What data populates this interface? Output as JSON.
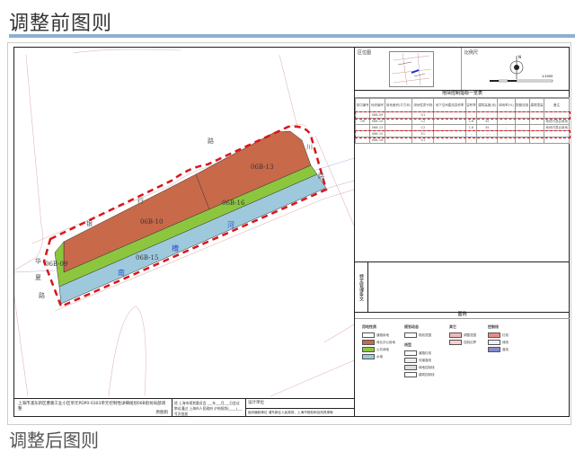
{
  "page": {
    "title": "调整前图则",
    "next_title": "调整后图则"
  },
  "map": {
    "parcels": [
      "06B-09",
      "06B-10",
      "06B-13",
      "06B-15",
      "06B-16"
    ],
    "roads": {
      "top": [
        "银",
        "行",
        "路"
      ],
      "left": [
        "华",
        "夏",
        "路"
      ],
      "right": [
        "川",
        "路"
      ]
    },
    "river": [
      "南",
      "槽",
      "河"
    ],
    "colors": {
      "commercial": "#c8694a",
      "green": "#8cc63f",
      "water": "#9ec9dc",
      "boundary": "#d9141b"
    }
  },
  "panel": {
    "location_label": "区位图",
    "scale_label": "比例尺",
    "scale_value": "1:2000",
    "north": "N",
    "table_title": "地块控制指标一览表",
    "table_headers": [
      "街坊编号",
      "地块编号",
      "用地面积(平方米)",
      "用地性质代码",
      "地下空间建设容积率",
      "容积率",
      "建筑高度(米)",
      "绿地率(%)",
      "配套设施",
      "建筑限高",
      "备注"
    ],
    "table_rows": [
      [
        "",
        "06B-09",
        "",
        "G1",
        "",
        "-",
        "-",
        "-",
        "",
        "",
        ""
      ],
      [
        "06",
        "06B-10",
        "",
        "C2",
        "",
        "1.6",
        "45",
        "-",
        "",
        "",
        "地块内混合用地"
      ],
      [
        "",
        "06B-13",
        "",
        "C2",
        "",
        "1.6",
        "45",
        "-",
        "",
        "",
        "地块内混合用地"
      ],
      [
        "",
        "06B-15",
        "",
        "E1",
        "",
        "-",
        "-",
        "-",
        "",
        "",
        ""
      ],
      [
        "",
        "06B-16",
        "",
        "G1",
        "",
        "-",
        "-",
        "-",
        "",
        "",
        ""
      ]
    ],
    "special_label": "特定管理条文",
    "legend_title": "图例",
    "legend": {
      "land_use": {
        "title": "用地性质",
        "items": [
          "道路用地",
          "商业办公用地",
          "公共绿地",
          "水域"
        ]
      },
      "status": {
        "title": "规划动态",
        "items": [
          "规划范围"
        ]
      },
      "lines": {
        "title": "线型",
        "items": [
          "道路红线",
          "河道蓝线",
          "绿地控制线",
          "建筑控制线"
        ]
      },
      "other": {
        "title": "其它",
        "items": [
          "调整范围",
          "控制边界"
        ]
      },
      "control": {
        "title": "控制线",
        "items": [
          "红线",
          "绿线",
          "蓝线"
        ]
      }
    }
  },
  "info": {
    "project": "上海市浦东新区曹路工业小区单元PDP0-0303单元控制性详细规划06B街坊局部调整",
    "sheet": "原图则",
    "approval": "经 上海市规划委员会 ___年___月___日会议审议通过 上海市人民政府 沪府规划(____)___号文批准",
    "designer_label": "设计单位",
    "org_label": "组织编制单位",
    "org": "浦东新区人民政府、上海市规划和自然资源局"
  }
}
